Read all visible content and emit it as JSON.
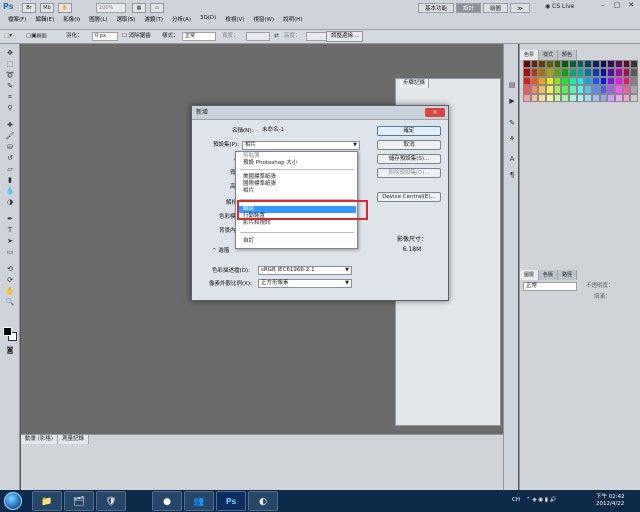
{
  "app": {
    "logo": "Ps",
    "menu": [
      "檔案(F)",
      "編輯(E)",
      "影像(I)",
      "圖層(L)",
      "選取(S)",
      "濾鏡(T)",
      "分析(A)",
      "3D(D)",
      "檢視(V)",
      "視窗(W)",
      "說明(H)"
    ],
    "zoom": "100%",
    "workspaces": [
      "基本功能",
      "設計",
      "繪圖",
      "≫"
    ],
    "active_workspace": "設計",
    "cs_live": "CS Live",
    "window_controls": [
      "–",
      "□",
      "✕"
    ]
  },
  "options": {
    "feather_label": "羽化：",
    "feather_value": "0 px",
    "antialias": "消除鋸齒",
    "style_label": "樣式：",
    "style_value": "正常",
    "width_label": "寬度：",
    "height_label": "高度：",
    "refine_btn": "調整邊緣..."
  },
  "history_panel": {
    "tab": "步驟記錄"
  },
  "right_panel": {
    "color_tabs": [
      "色票",
      "樣式",
      "顏色"
    ],
    "layer_tabs": [
      "圖層",
      "色版",
      "路徑"
    ],
    "blend_mode": "正常",
    "opacity_label": "不透明度：",
    "fill_label": "填滿："
  },
  "bottom_panel": {
    "tabs": [
      "動畫 (影格)",
      "測量記錄"
    ]
  },
  "dialog": {
    "title": "新增",
    "close": "✕",
    "name_label": "名稱(N):",
    "name_value": "未命名-1",
    "preset_label": "預設集(P):",
    "preset_value": "相片",
    "size_label": "尺寸",
    "width_label": "寬度",
    "height_label": "高度",
    "resolution_label": "解析度",
    "color_mode_label": "色彩模式",
    "bg_label": "背景內容",
    "advanced_label": "進階",
    "profile_label": "色彩描述檔(O):",
    "profile_value": "sRGB IEC61966-2.1",
    "pixel_aspect_label": "像素外觀比例(X):",
    "pixel_aspect_value": "正方形像素",
    "buttons": {
      "ok": "確定",
      "cancel": "取消",
      "save_preset": "儲存預設集(S)...",
      "delete_preset": "刪除預設集(D)...",
      "device_central": "Device Central(E)..."
    },
    "image_size_label": "影像尺寸：",
    "image_size_value": "6.18M",
    "dropdown_items": [
      "剪貼簿",
      "預設 Photoshop 大小",
      "美國標準紙張",
      "國際標準紙張",
      "相片",
      "網頁",
      "行動裝置",
      "影片和視訊",
      "自訂"
    ],
    "dropdown_selected": "網頁"
  },
  "taskbar": {
    "apps": [
      "📁",
      "🗂",
      "🛡",
      "●",
      "👥",
      "Ps",
      "◐"
    ],
    "ch_label": "CH",
    "time": "下午 02:42",
    "date": "2012/4/22"
  }
}
